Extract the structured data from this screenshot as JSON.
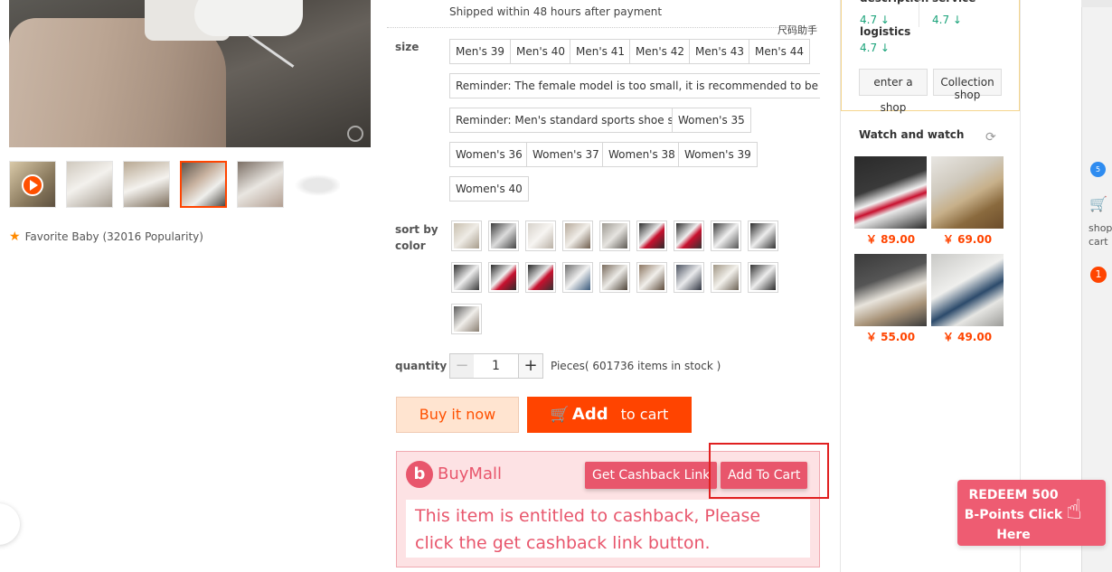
{
  "gallery": {
    "favorite_text": "Favorite Baby (32016 Popularity)"
  },
  "shipping": {
    "text": "Shipped within 48 hours after payment",
    "size_helper": "尺码助手"
  },
  "size": {
    "label": "size",
    "options": [
      "Men's 39",
      "Men's 40",
      "Men's 41",
      "Men's 42",
      "Men's 43",
      "Men's 44",
      "Reminder: The female model is too small, it is recommended to be a big size",
      "Reminder: Men's standard sports shoe size",
      "Women's 35",
      "Women's 36",
      "Women's 37",
      "Women's 38",
      "Women's 39",
      "Women's 40"
    ]
  },
  "color": {
    "label": "sort by color"
  },
  "quantity": {
    "label": "quantity",
    "minus": "−",
    "value": "1",
    "plus": "+",
    "stock_text": "Pieces( 601736 items in stock )"
  },
  "actions": {
    "buy_now": "Buy it now",
    "add_cart_part1": "Add",
    "add_cart_part2": "to cart"
  },
  "buymall": {
    "logo_glyph": "b",
    "name": "BuyMall",
    "cashback_button": "Get Cashback Link",
    "add_to_cart_button": "Add To Cart",
    "message": "This item is entitled to cashback, Please click the get cashback link button."
  },
  "seller": {
    "scores": [
      {
        "label": "description",
        "value": "4.7 ↓"
      },
      {
        "label": "service",
        "value": "4.7 ↓"
      },
      {
        "label": "logistics",
        "value": "4.7 ↓"
      }
    ],
    "enter_shop": "enter a shop",
    "collection_shop": "Collection shop"
  },
  "watch": {
    "title": "Watch and watch",
    "items": [
      {
        "price": "￥ 89.00"
      },
      {
        "price": "￥ 69.00"
      },
      {
        "price": "￥ 55.00"
      },
      {
        "price": "￥ 49.00"
      }
    ]
  },
  "toolbar": {
    "dot_text": "5",
    "cart_text": "shop cart",
    "cart_count": "1"
  },
  "promo": {
    "text": "REDEEM 500 B-Points Click Here"
  },
  "colors": {
    "accent": "#ff4400",
    "buymall_pink": "#e8566c",
    "score_green": "#1aa37a"
  }
}
